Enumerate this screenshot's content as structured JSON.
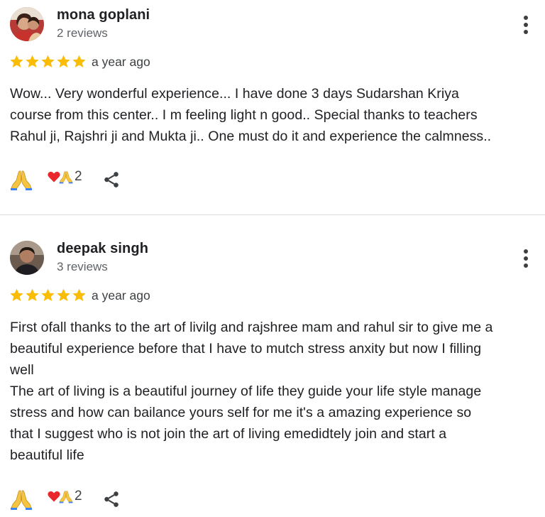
{
  "reviews": [
    {
      "author": "mona goplani",
      "review_count": "2 reviews",
      "rating": 5,
      "date": "a year ago",
      "text": "Wow... Very wonderful experience... I have done 3 days Sudarshan Kriya\ncourse from this center.. I m feeling light n good.. Special thanks to teachers\nRahul ji, Rajshri ji and Mukta ji.. One must do it and experience the calmness..",
      "reaction_count": "2",
      "avatar_icon": "woman-photo-avatar",
      "star_color": "#fbbc04"
    },
    {
      "author": "deepak singh",
      "review_count": "3 reviews",
      "rating": 5,
      "date": "a year ago",
      "text": "First ofall thanks to the art of livilg and rajshree mam and rahul sir to give me a\nbeautiful experience before that I have to mutch stress anxity but now I filling\nwell\nThe art of living is a beautiful journey of life they guide your life style manage\nstress and how can bailance yours self for me it's a amazing experience so\nthat I suggest who is not join the art of living emedidtely join and start a\nbeautiful life",
      "reaction_count": "2",
      "avatar_icon": "man-photo-avatar",
      "star_color": "#fbbc04"
    }
  ]
}
